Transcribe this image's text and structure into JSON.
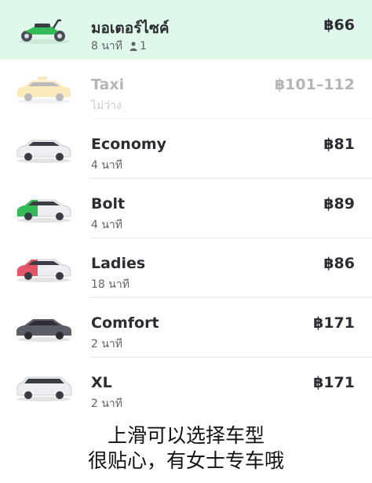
{
  "options": [
    {
      "name": "มอเตอร์ไซค์",
      "sub": "8 นาที",
      "seats": "1",
      "price": "฿66",
      "vehicle": "motorbike-icon",
      "state": "selected"
    },
    {
      "name": "Taxi",
      "sub": "ไม่ว่าง",
      "price": "฿101–112",
      "vehicle": "taxi-car-icon",
      "state": "unavailable"
    },
    {
      "name": "Economy",
      "sub": "4 นาที",
      "price": "฿81",
      "vehicle": "economy-car-icon",
      "state": "normal"
    },
    {
      "name": "Bolt",
      "sub": "4 นาที",
      "price": "฿89",
      "vehicle": "bolt-car-icon",
      "state": "normal"
    },
    {
      "name": "Ladies",
      "sub": "18 นาที",
      "price": "฿86",
      "vehicle": "ladies-car-icon",
      "state": "normal"
    },
    {
      "name": "Comfort",
      "sub": "2 นาที",
      "price": "฿171",
      "vehicle": "comfort-car-icon",
      "state": "normal"
    },
    {
      "name": "XL",
      "sub": "2 นาที",
      "price": "฿171",
      "vehicle": "xl-van-icon",
      "state": "normal"
    }
  ],
  "colors": {
    "selected_bg": "#dff8ea",
    "bolt_green": "#34bb57",
    "taxi_yellow": "#f5c542",
    "ladies_pink": "#e3566a",
    "comfort_gray": "#5b5e66"
  },
  "caption": {
    "line1": "上滑可以选择车型",
    "line2": "很贴心，有女士专车哦"
  }
}
